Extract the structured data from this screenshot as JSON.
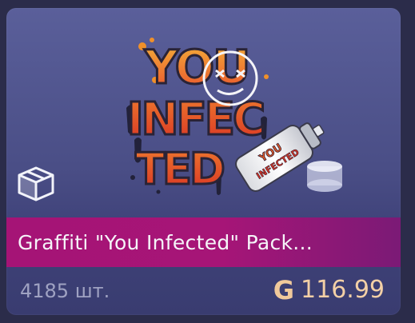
{
  "item": {
    "title": "Graffiti \"You Infected\" Pack...",
    "stock": "4185 шт.",
    "currency_symbol": "G",
    "price": "116.99",
    "art_text_lines": [
      "YOU",
      "INFEC",
      "TED"
    ],
    "can_text": "YOU INFECTED"
  },
  "icons": {
    "pack": "box-icon",
    "coin": "g-coin-icon"
  },
  "colors": {
    "background": "#2b2c4a",
    "card_top": "#5a5f9a",
    "title_bar": "#a51476",
    "price_text": "#f3d0a6",
    "stock_text": "#9fa2c2",
    "graffiti_orange": "#f09a2a",
    "graffiti_red": "#e8452a"
  }
}
